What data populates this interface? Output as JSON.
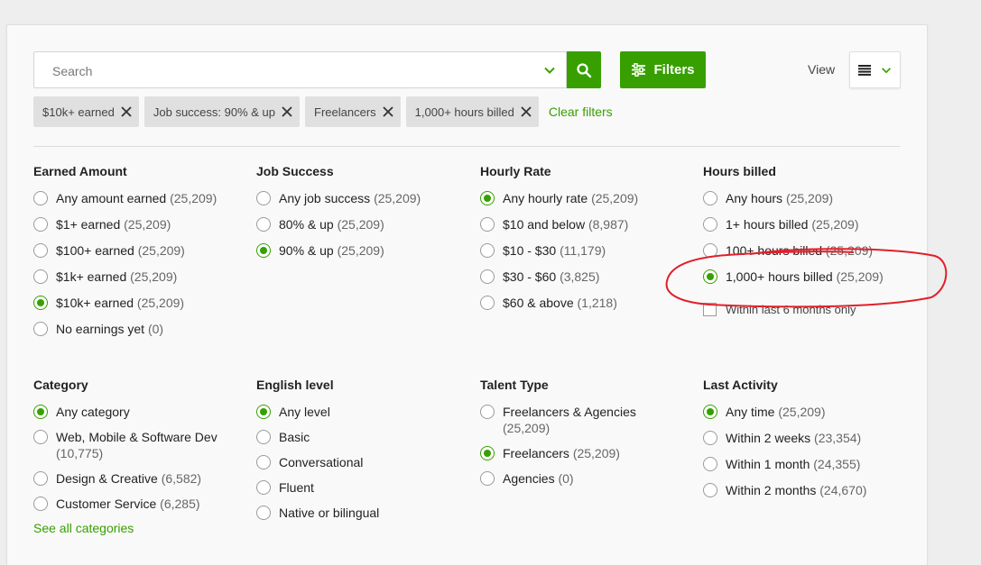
{
  "search": {
    "placeholder": "Search"
  },
  "toolbar": {
    "filters_label": "Filters",
    "view_label": "View"
  },
  "chips": [
    {
      "label": "$10k+ earned"
    },
    {
      "label": "Job success: 90% & up"
    },
    {
      "label": "Freelancers"
    },
    {
      "label": "1,000+ hours billed"
    }
  ],
  "clear_filters": "Clear filters",
  "sections": {
    "earned": {
      "title": "Earned Amount",
      "options": [
        {
          "label": "Any amount earned",
          "count": "(25,209)",
          "selected": false
        },
        {
          "label": "$1+ earned",
          "count": "(25,209)",
          "selected": false
        },
        {
          "label": "$100+ earned",
          "count": "(25,209)",
          "selected": false
        },
        {
          "label": "$1k+ earned",
          "count": "(25,209)",
          "selected": false
        },
        {
          "label": "$10k+ earned",
          "count": "(25,209)",
          "selected": true
        },
        {
          "label": "No earnings yet",
          "count": "(0)",
          "selected": false
        }
      ]
    },
    "job_success": {
      "title": "Job Success",
      "options": [
        {
          "label": "Any job success",
          "count": "(25,209)",
          "selected": false
        },
        {
          "label": "80% & up",
          "count": "(25,209)",
          "selected": false
        },
        {
          "label": "90% & up",
          "count": "(25,209)",
          "selected": true
        }
      ]
    },
    "hourly_rate": {
      "title": "Hourly Rate",
      "options": [
        {
          "label": "Any hourly rate",
          "count": "(25,209)",
          "selected": true
        },
        {
          "label": "$10 and below",
          "count": "(8,987)",
          "selected": false
        },
        {
          "label": "$10 - $30",
          "count": "(11,179)",
          "selected": false
        },
        {
          "label": "$30 - $60",
          "count": "(3,825)",
          "selected": false
        },
        {
          "label": "$60 & above",
          "count": "(1,218)",
          "selected": false
        }
      ]
    },
    "hours_billed": {
      "title": "Hours billed",
      "options": [
        {
          "label": "Any hours",
          "count": "(25,209)",
          "selected": false
        },
        {
          "label": "1+ hours billed",
          "count": "(25,209)",
          "selected": false
        },
        {
          "label": "100+ hours billed",
          "count": "(25,209)",
          "selected": false
        },
        {
          "label": "1,000+ hours billed",
          "count": "(25,209)",
          "selected": true
        }
      ],
      "checkbox_label": "Within last 6 months only"
    },
    "category": {
      "title": "Category",
      "options": [
        {
          "label": "Any category",
          "count": "",
          "selected": true
        },
        {
          "label": "Web, Mobile & Software Dev",
          "count": "(10,775)",
          "selected": false
        },
        {
          "label": "Design & Creative",
          "count": "(6,582)",
          "selected": false
        },
        {
          "label": "Customer Service",
          "count": "(6,285)",
          "selected": false
        }
      ],
      "see_all": "See all categories"
    },
    "english": {
      "title": "English level",
      "options": [
        {
          "label": "Any level",
          "count": "",
          "selected": true
        },
        {
          "label": "Basic",
          "count": "",
          "selected": false
        },
        {
          "label": "Conversational",
          "count": "",
          "selected": false
        },
        {
          "label": "Fluent",
          "count": "",
          "selected": false
        },
        {
          "label": "Native or bilingual",
          "count": "",
          "selected": false
        }
      ]
    },
    "talent_type": {
      "title": "Talent Type",
      "options": [
        {
          "label": "Freelancers & Agencies",
          "count": "(25,209)",
          "selected": false
        },
        {
          "label": "Freelancers",
          "count": "(25,209)",
          "selected": true
        },
        {
          "label": "Agencies",
          "count": "(0)",
          "selected": false
        }
      ]
    },
    "last_activity": {
      "title": "Last Activity",
      "options": [
        {
          "label": "Any time",
          "count": "(25,209)",
          "selected": true
        },
        {
          "label": "Within 2 weeks",
          "count": "(23,354)",
          "selected": false
        },
        {
          "label": "Within 1 month",
          "count": "(24,355)",
          "selected": false
        },
        {
          "label": "Within 2 months",
          "count": "(24,670)",
          "selected": false
        }
      ]
    }
  },
  "colors": {
    "accent": "#37a000",
    "annotation": "#e0202a"
  },
  "icons": [
    "search-icon",
    "chevron-down-icon",
    "sliders-icon",
    "list-view-icon",
    "close-icon"
  ]
}
